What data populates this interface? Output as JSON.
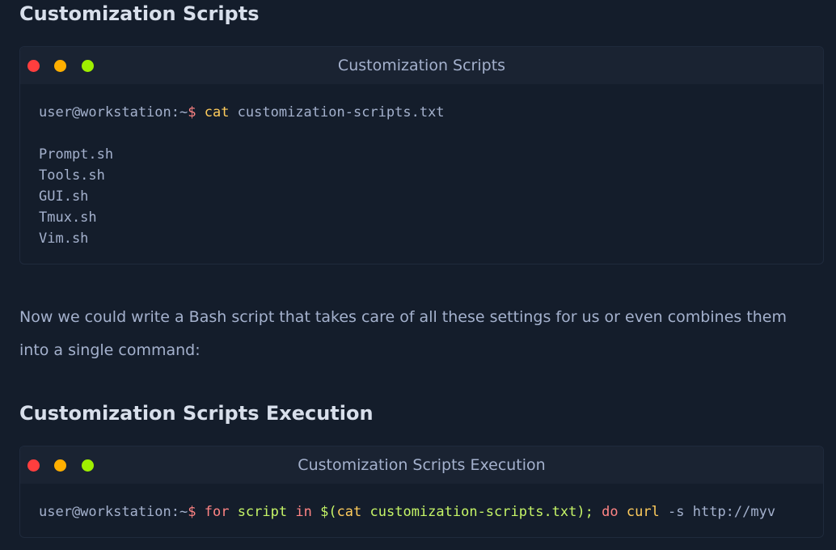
{
  "section1": {
    "heading": "Customization Scripts",
    "terminal": {
      "title": "Customization Scripts",
      "prompt": "user@workstation:~",
      "dollar": "$ ",
      "command": "cat",
      "argument": " customization-scripts.txt",
      "output": [
        "Prompt.sh",
        "Tools.sh",
        "GUI.sh",
        "Tmux.sh",
        "Vim.sh"
      ]
    }
  },
  "paragraph": "Now we could write a Bash script that takes care of all these settings for us or even combines them into a single command:",
  "section2": {
    "heading": "Customization Scripts Execution",
    "terminal": {
      "title": "Customization Scripts Execution",
      "prompt": "user@workstation:~",
      "dollar": "$ ",
      "tokens": {
        "for": "for",
        "space1": " ",
        "script": "script",
        "space2": " ",
        "in": "in",
        "subshell_open": " $(",
        "cat": "cat",
        "file": " customization-scripts.txt",
        "subshell_close": "); ",
        "do": "do",
        "space3": " ",
        "curl": "curl",
        "rest": " -s http://myv"
      }
    }
  },
  "colors": {
    "background": "#141d2b",
    "bar": "#1a2332",
    "text": "#a4b1cd",
    "heading": "#d8dfeb",
    "red_dot": "#ff3e3e",
    "yellow_dot": "#ffaf00",
    "green_dot": "#9fef00",
    "keyword": "#ff8484",
    "command": "#ffcc5c",
    "variable": "#c5f467"
  }
}
